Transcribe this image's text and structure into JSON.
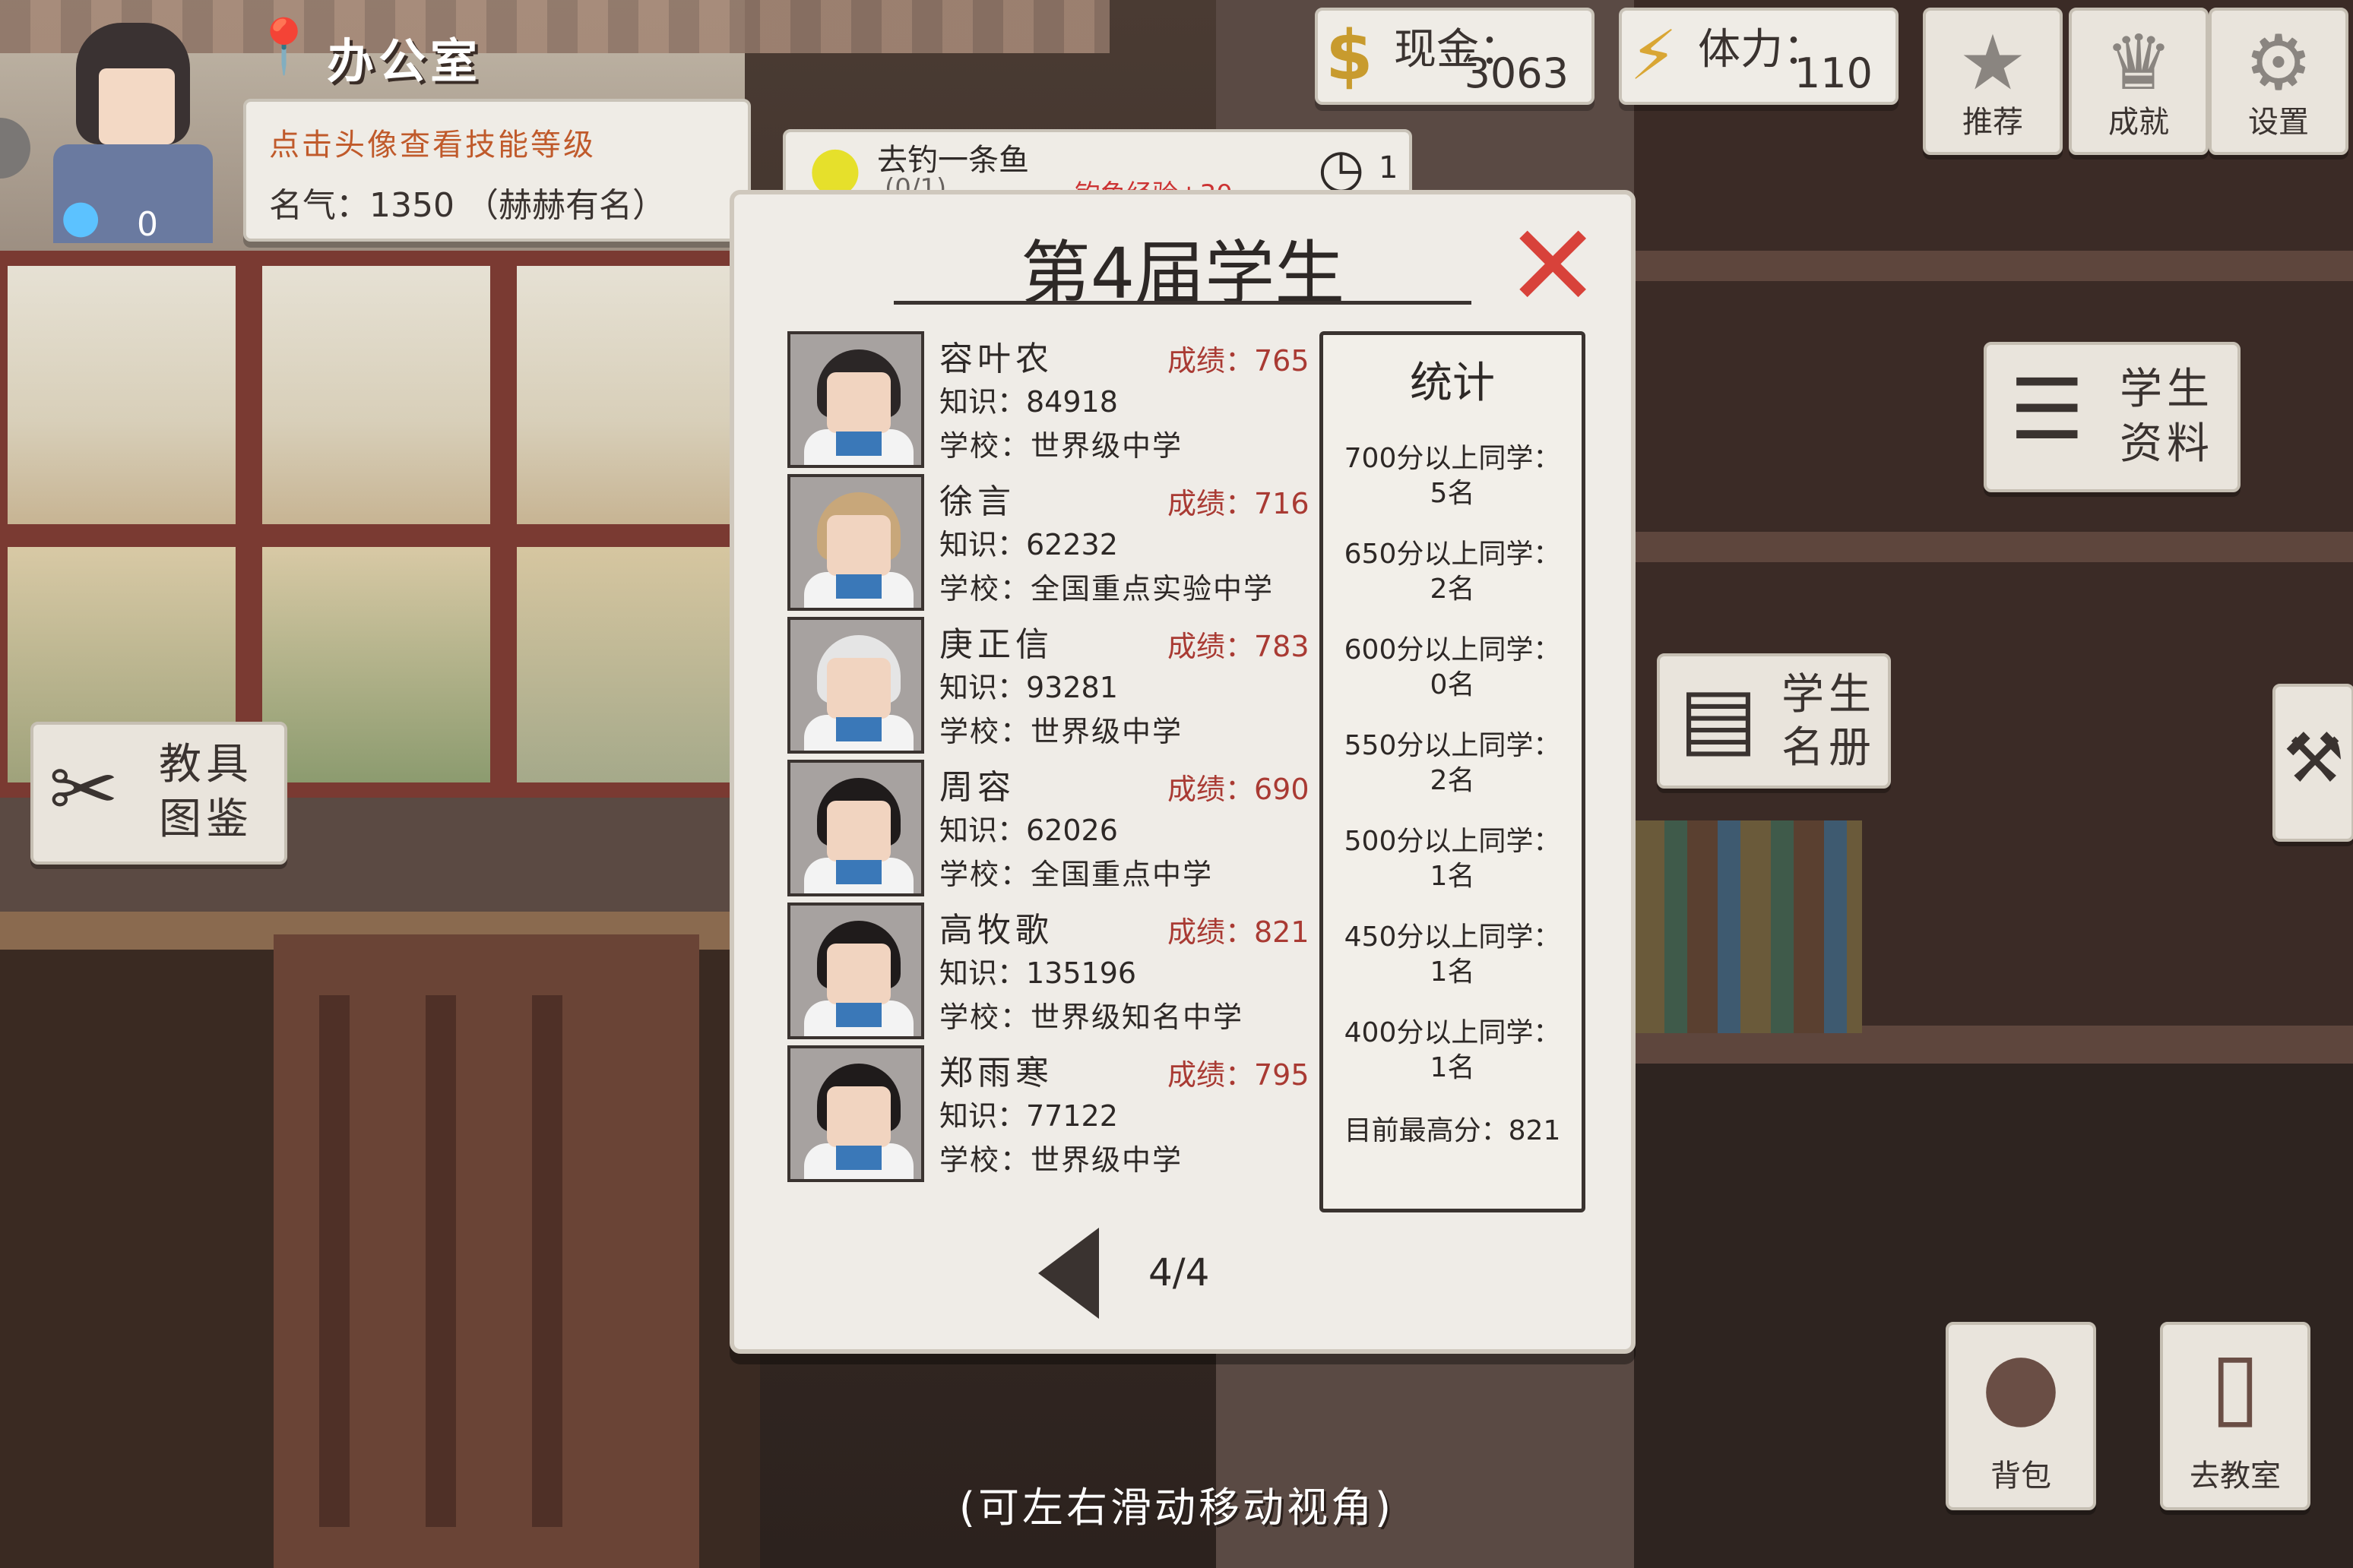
{
  "header": {
    "room_title": "办公室",
    "hint": "点击头像查看技能等级",
    "fame": "名气：1350  （赫赫有名）",
    "bulb_count": "0"
  },
  "resources": {
    "cash_label": "现金：",
    "cash_value": "3063",
    "energy_label": "体力：",
    "energy_value": "110"
  },
  "top_buttons": {
    "recommend": "推荐",
    "achievement": "成就",
    "settings": "设置"
  },
  "quest": {
    "title": "去钓一条鱼",
    "progress": "(0/1)",
    "reward": "钓鱼经验+30",
    "clock_count": "1"
  },
  "panel": {
    "title": "第4届学生",
    "page": "4/4",
    "students": [
      {
        "name": "容叶农",
        "grade": "成绩：765",
        "knowledge": "知识：84918",
        "school": "学校：世界级中学",
        "hair": "#2b2626"
      },
      {
        "name": "徐言",
        "grade": "成绩：716",
        "knowledge": "知识：62232",
        "school": "学校：全国重点实验中学",
        "hair": "#c8a77a"
      },
      {
        "name": "庚正信",
        "grade": "成绩：783",
        "knowledge": "知识：93281",
        "school": "学校：世界级中学",
        "hair": "#e5e5e5"
      },
      {
        "name": "周容",
        "grade": "成绩：690",
        "knowledge": "知识：62026",
        "school": "学校：全国重点中学",
        "hair": "#1f1b1b"
      },
      {
        "name": "高牧歌",
        "grade": "成绩：821",
        "knowledge": "知识：135196",
        "school": "学校：世界级知名中学",
        "hair": "#1f1b1b"
      },
      {
        "name": "郑雨寒",
        "grade": "成绩：795",
        "knowledge": "知识：77122",
        "school": "学校：世界级中学",
        "hair": "#1f1b1b"
      }
    ],
    "stats": {
      "title": "统计",
      "lines": [
        {
          "label": "700分以上同学：",
          "value": "5名"
        },
        {
          "label": "650分以上同学：",
          "value": "2名"
        },
        {
          "label": "600分以上同学：",
          "value": "0名"
        },
        {
          "label": "550分以上同学：",
          "value": "2名"
        },
        {
          "label": "500分以上同学：",
          "value": "1名"
        },
        {
          "label": "450分以上同学：",
          "value": "1名"
        },
        {
          "label": "400分以上同学：",
          "value": "1名"
        }
      ],
      "top_score": "目前最高分：821"
    }
  },
  "side": {
    "tools_line1": "教具",
    "tools_line2": "图鉴",
    "profile_line1": "学生",
    "profile_line2": "资料",
    "roster_line1": "学生",
    "roster_line2": "名册"
  },
  "bottom": {
    "bag": "背包",
    "classroom": "去教室"
  },
  "footer_hint": "(可左右滑动移动视角)",
  "colors": {
    "grade_red": "#a93a33",
    "close_red": "#d8423a",
    "hint_orange": "#c05a2b"
  }
}
